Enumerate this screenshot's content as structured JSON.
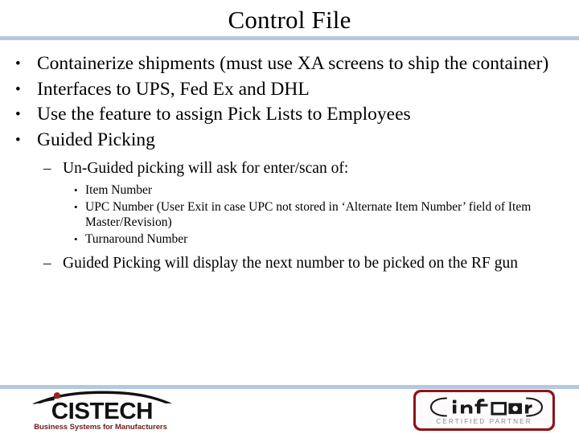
{
  "slide": {
    "title": "Control File",
    "divider_color": "#b6c8de",
    "background_color": "#ffffff",
    "text_color": "#000000"
  },
  "content": {
    "bullets": [
      {
        "level": 1,
        "marker": "•",
        "text": "Containerize shipments (must use XA screens to ship the container)"
      },
      {
        "level": 1,
        "marker": "•",
        "text": "Interfaces to UPS, Fed Ex and DHL"
      },
      {
        "level": 1,
        "marker": "•",
        "text": "Use the feature to assign Pick Lists to Employees"
      },
      {
        "level": 1,
        "marker": "•",
        "text": "Guided Picking"
      },
      {
        "level": 2,
        "marker": "–",
        "text": "Un-Guided picking will ask for enter/scan of:"
      },
      {
        "level": 3,
        "marker": "•",
        "text": "Item Number"
      },
      {
        "level": 3,
        "marker": "•",
        "text": "UPC Number (User Exit in case UPC not stored in ‘Alternate Item Number’ field of Item Master/Revision)"
      },
      {
        "level": 3,
        "marker": "•",
        "text": "Turnaround Number"
      },
      {
        "level": 2,
        "marker": "–",
        "text": "Guided Picking will display the next number to be picked on the RF gun"
      }
    ]
  },
  "footer": {
    "cistech_logo": {
      "wordmark": "CISTECH",
      "tagline": "Business Systems for Manufacturers",
      "accent_color": "#a41d21",
      "wordmark_color": "#111111",
      "tagline_color": "#6e1d1d"
    },
    "infor_logo": {
      "wordmark": "infor",
      "subtitle": "CERTIFIED PARTNER",
      "frame_color": "#8d1416",
      "subtitle_color": "#8c8c8c"
    }
  }
}
